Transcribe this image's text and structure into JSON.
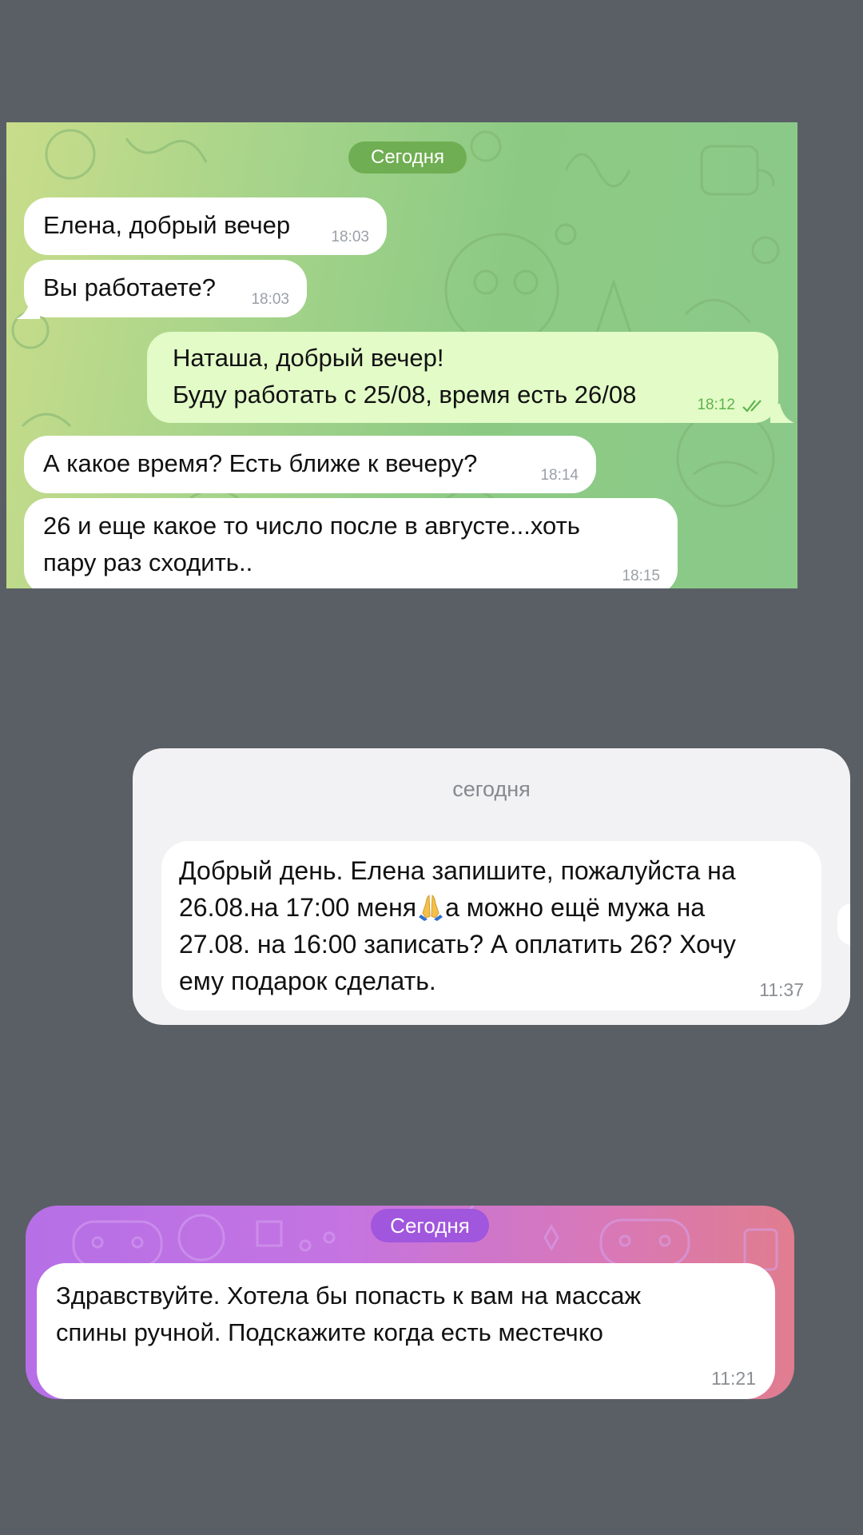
{
  "panel1": {
    "date": "Сегодня",
    "messages": [
      {
        "text": "Елена, добрый вечер",
        "time": "18:03",
        "dir": "in"
      },
      {
        "text": "Вы работаете?",
        "time": "18:03",
        "dir": "in"
      },
      {
        "text": "Наташа, добрый вечер!\nБуду работать с 25/08, время есть 26/08",
        "time": "18:12",
        "dir": "out"
      },
      {
        "text": "А какое время? Есть ближе к вечеру?",
        "time": "18:14",
        "dir": "in"
      },
      {
        "text": "26 и еще какое то число после в августе...хоть\nпару раз сходить..",
        "time": "18:15",
        "dir": "in"
      }
    ]
  },
  "panel2": {
    "date": "сегодня",
    "message": {
      "text_part1": "Добрый день. Елена запишите, пожалуйста на\n26.08.на 17:00 меня",
      "emoji": "folded-hands",
      "text_part2": "а можно ещё мужа на\n27.08. на 16:00 записать?  А оплатить 26? Хочу\nему подарок сделать.",
      "time": "11:37"
    }
  },
  "panel3": {
    "date": "Сегодня",
    "message": {
      "text": "Здравствуйте. Хотела бы попасть к вам на массаж\nспины ручной. Подскажите когда есть местечко",
      "time": "11:21"
    }
  },
  "colors": {
    "page_bg": "#5a5f66",
    "telegram_pill": "#6fae52",
    "outgoing_bubble": "#e2fbc7",
    "read_checks": "#5fb34c",
    "panel3_pill": "#a056dd"
  }
}
